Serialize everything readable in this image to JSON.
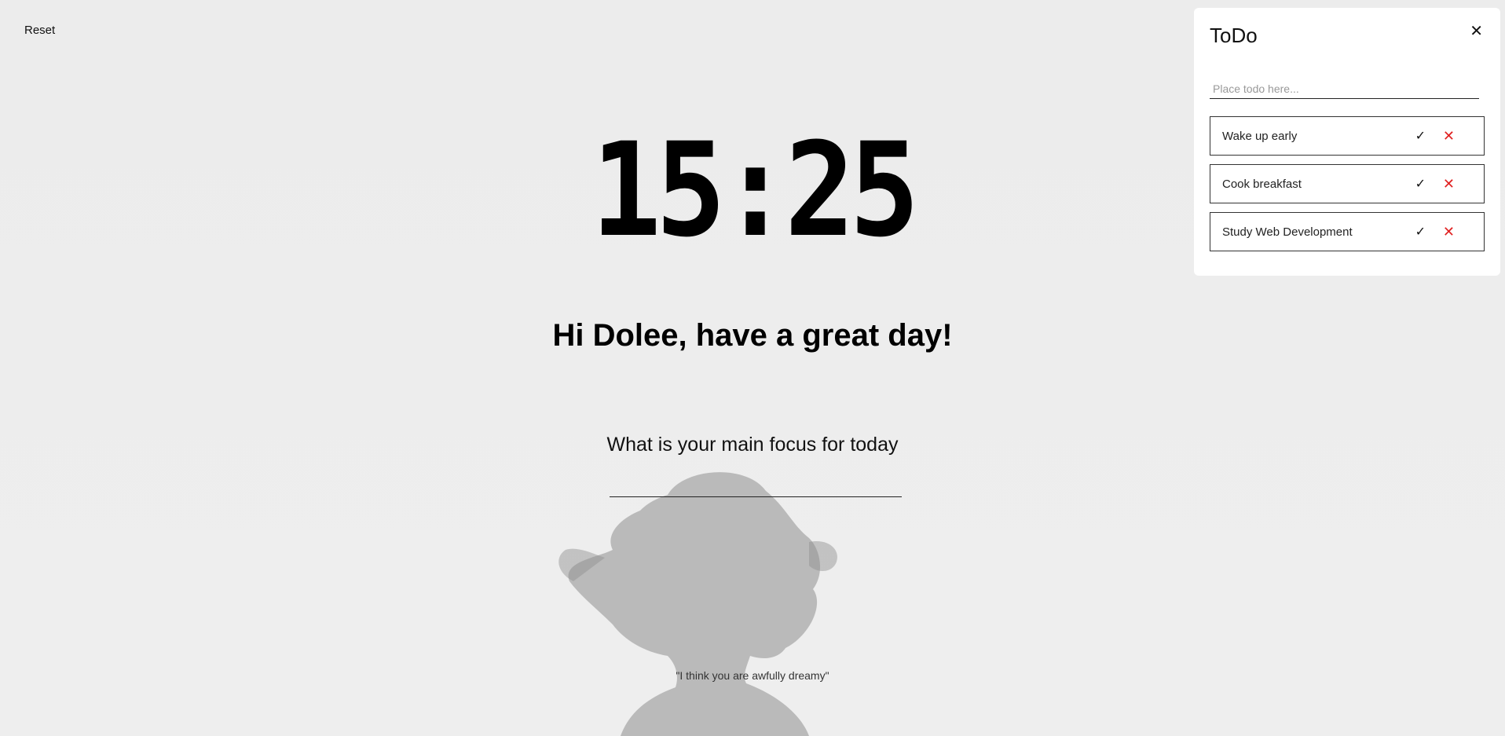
{
  "header": {
    "reset_label": "Reset"
  },
  "clock": {
    "time": "15:25"
  },
  "greeting": {
    "text": "Hi Dolee, have a great day!"
  },
  "focus": {
    "question": "What is your main focus for today",
    "value": ""
  },
  "quote": {
    "text": "\"I think you are awfully dreamy\""
  },
  "todo": {
    "title": "ToDo",
    "close_icon": "close-icon",
    "close_glyph": "✕",
    "input_placeholder": "Place todo here...",
    "check_glyph": "✓",
    "delete_glyph": "✕",
    "delete_color": "#e02020",
    "items": [
      {
        "label": "Wake up early"
      },
      {
        "label": "Cook breakfast"
      },
      {
        "label": "Study Web Development"
      }
    ]
  }
}
